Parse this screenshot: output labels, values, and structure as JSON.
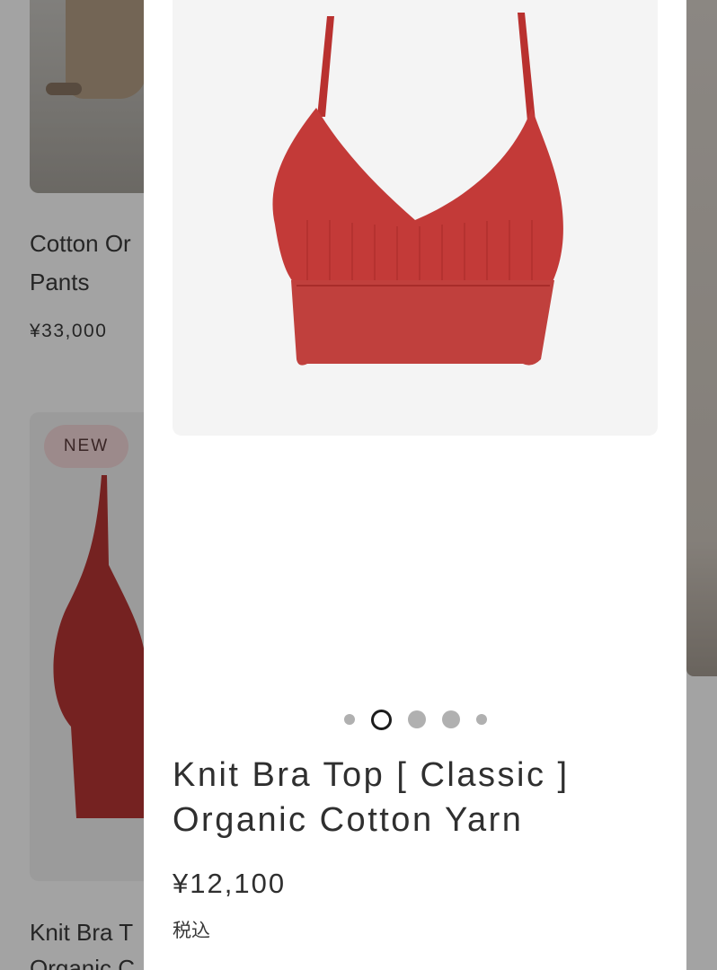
{
  "background_list": {
    "items": [
      {
        "title": "Cotton Or\nPants",
        "price": "¥33,000"
      },
      {
        "badge": "NEW",
        "title": "Knit Bra T\nOrganic C"
      }
    ]
  },
  "product": {
    "title_line1": "Knit Bra Top [ Classic ]",
    "title_line2": "Organic Cotton Yarn",
    "price": "¥12,100",
    "tax_note": "税込",
    "image_icon": "red-knit-bra-top-image"
  },
  "carousel": {
    "total": 5,
    "active_index": 1
  },
  "colors": {
    "product_red": "#c23a38",
    "dot_active": "#1c1c1c",
    "dot_inactive": "#b0b0b0",
    "badge_bg": "#f4d8d9"
  }
}
